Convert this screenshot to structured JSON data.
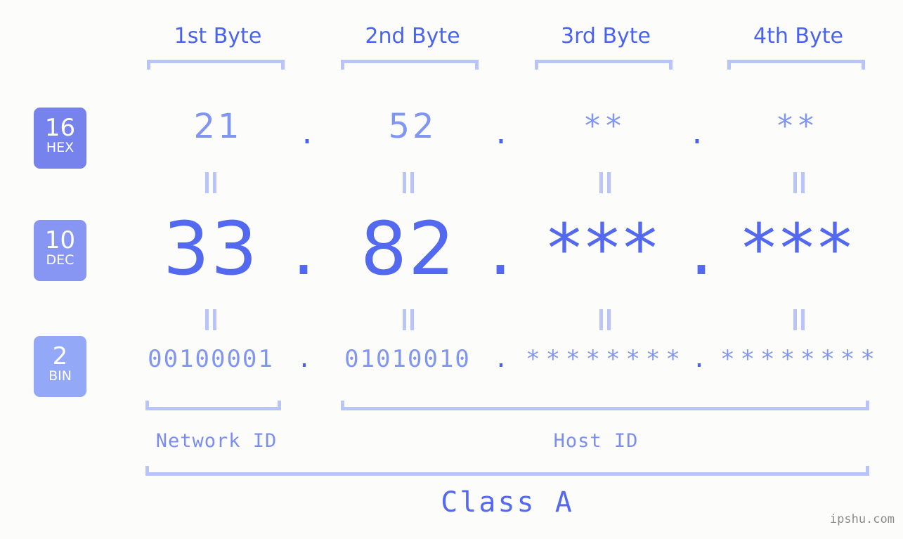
{
  "meta": {
    "background_color": "#fcfdfa",
    "accent_color": "#5269f0",
    "accent_light_color": "#8196f0",
    "bracket_color": "#b9c4fb",
    "watermark": "ipshu.com"
  },
  "byte_headers": [
    {
      "label": "1st Byte"
    },
    {
      "label": "2nd Byte"
    },
    {
      "label": "3rd Byte"
    },
    {
      "label": "4th Byte"
    }
  ],
  "bases": [
    {
      "id": "hex",
      "number": "16",
      "abbr": "HEX",
      "color": "#7683ec"
    },
    {
      "id": "dec",
      "number": "10",
      "abbr": "DEC",
      "color": "#8795f3"
    },
    {
      "id": "bin",
      "number": "2",
      "abbr": "BIN",
      "color": "#93a8f7"
    }
  ],
  "rows": {
    "hex": {
      "bytes": [
        "21",
        "52",
        "**",
        "**"
      ],
      "separators": [
        ".",
        ".",
        "."
      ]
    },
    "dec": {
      "bytes": [
        "33",
        "82",
        "***",
        "***"
      ],
      "separators": [
        ".",
        ".",
        "."
      ]
    },
    "bin": {
      "bytes": [
        "00100001",
        "01010010",
        "********",
        "********"
      ],
      "separators": [
        ".",
        ".",
        "."
      ]
    }
  },
  "equality_marks": {
    "symbol": "=",
    "count_per_row": 4
  },
  "sections": [
    {
      "label": "Network ID"
    },
    {
      "label": "Host ID"
    }
  ],
  "class": {
    "label": "Class A"
  }
}
